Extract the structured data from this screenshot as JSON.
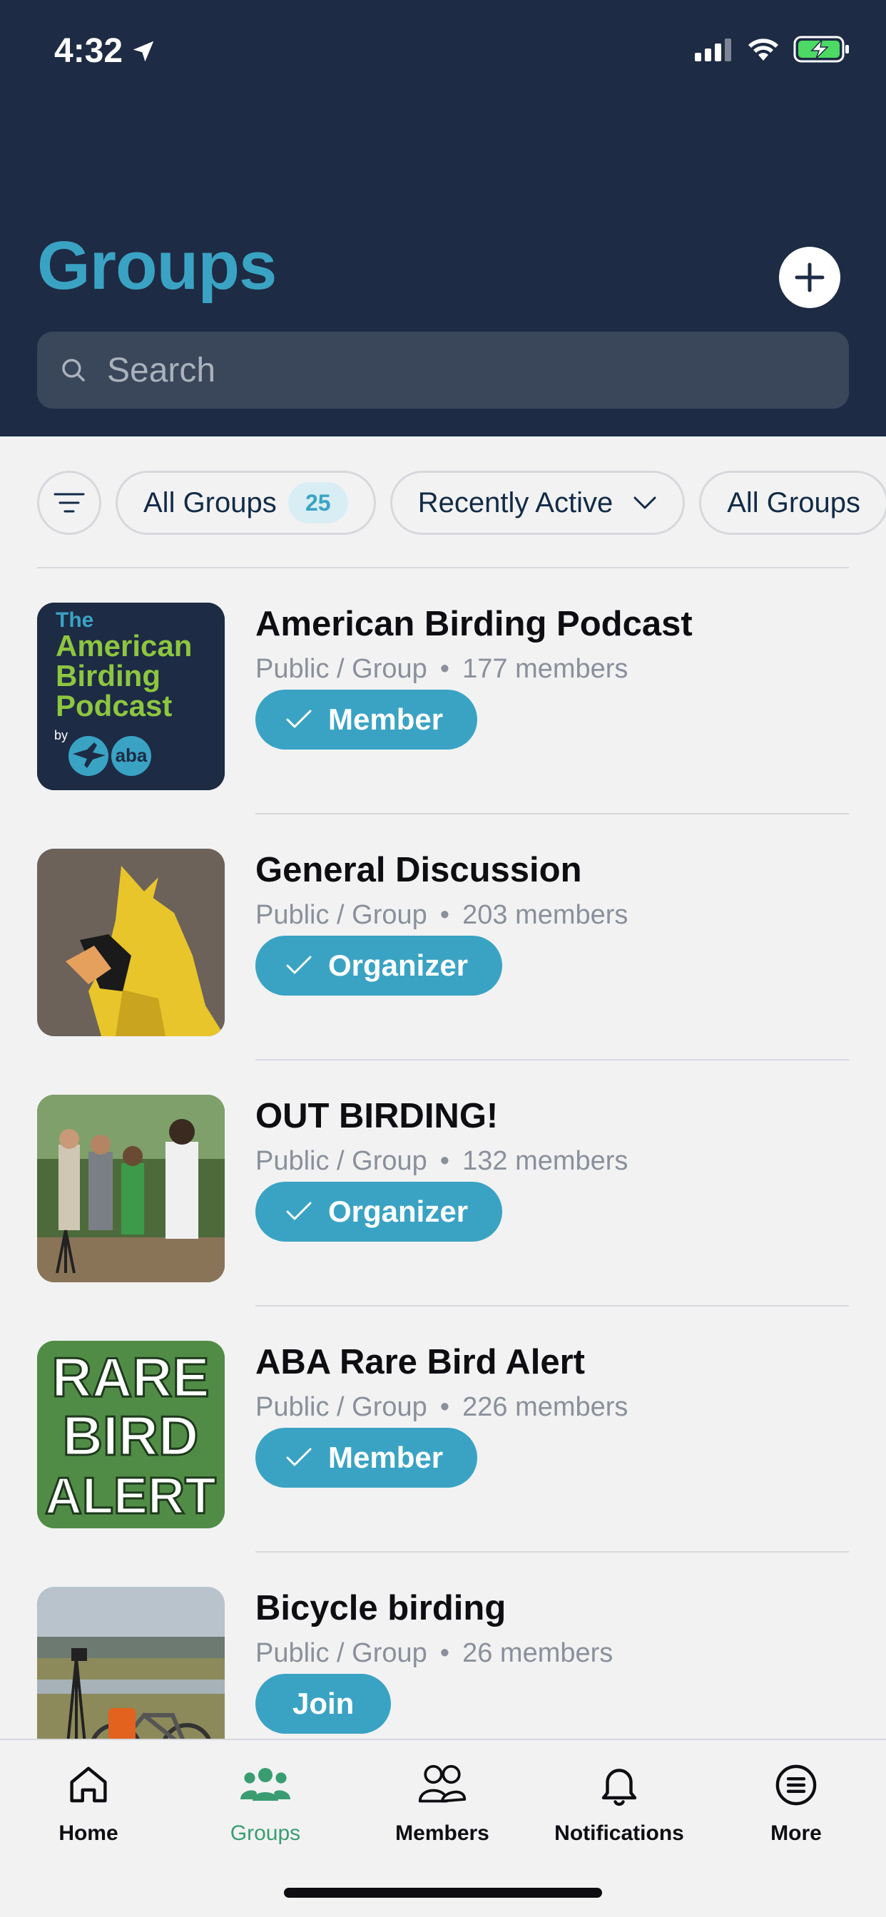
{
  "status_bar": {
    "time": "4:32"
  },
  "header": {
    "title": "Groups",
    "search_placeholder": "Search"
  },
  "filters": {
    "all_groups_label": "All Groups",
    "all_groups_count": "25",
    "sort_label": "Recently Active",
    "type_label": "All Groups"
  },
  "groups": [
    {
      "name": "American Birding Podcast",
      "privacy": "Public / Group",
      "members": "177 members",
      "role": "Member",
      "thumb_text": [
        "The",
        "American",
        "Birding",
        "Podcast"
      ],
      "thumb_by": "by",
      "thumb_aba": "aba"
    },
    {
      "name": "General Discussion",
      "privacy": "Public / Group",
      "members": "203 members",
      "role": "Organizer"
    },
    {
      "name": "OUT BIRDING!",
      "privacy": "Public / Group",
      "members": "132 members",
      "role": "Organizer"
    },
    {
      "name": "ABA Rare Bird Alert",
      "privacy": "Public / Group",
      "members": "226 members",
      "role": "Member",
      "thumb_text": [
        "RARE",
        "BIRD",
        "ALERT"
      ]
    },
    {
      "name": "Bicycle birding",
      "privacy": "Public / Group",
      "members": "26 members",
      "role": "Join"
    }
  ],
  "tabbar": {
    "items": [
      {
        "label": "Home",
        "icon": "home-icon"
      },
      {
        "label": "Groups",
        "icon": "groups-icon"
      },
      {
        "label": "Members",
        "icon": "members-icon"
      },
      {
        "label": "Notifications",
        "icon": "bell-icon"
      },
      {
        "label": "More",
        "icon": "menu-icon"
      }
    ]
  },
  "colors": {
    "header_bg": "#1e2b44",
    "accent": "#3aa3c4",
    "active_tab": "#3a9d72"
  }
}
